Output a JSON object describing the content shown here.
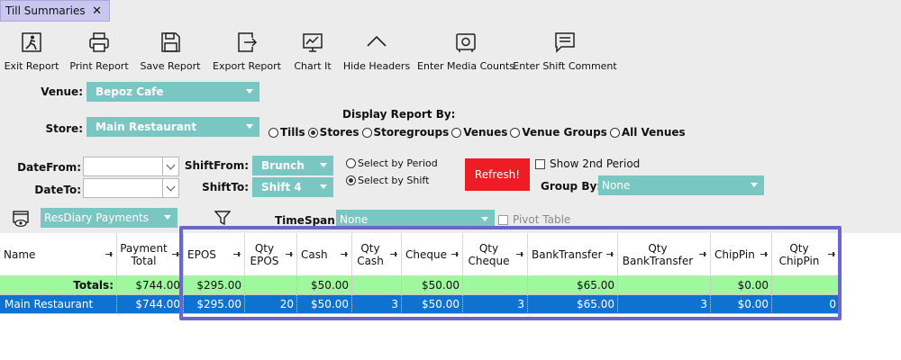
{
  "tab": {
    "title": "Till Summaries",
    "close": "✕"
  },
  "toolbar": [
    {
      "label": "Exit Report",
      "icon": "exit-icon"
    },
    {
      "label": "Print Report",
      "icon": "printer-icon"
    },
    {
      "label": "Save Report",
      "icon": "save-icon"
    },
    {
      "label": "Export Report",
      "icon": "export-icon"
    },
    {
      "label": "Chart It",
      "icon": "chart-icon"
    },
    {
      "label": "Hide Headers",
      "icon": "chevron-up-icon"
    },
    {
      "label": "Enter Media Counts",
      "icon": "safe-icon"
    },
    {
      "label": "Enter Shift Comment",
      "icon": "comment-icon"
    }
  ],
  "filters": {
    "venue_label": "Venue:",
    "venue_value": "Bepoz Cafe",
    "store_label": "Store:",
    "store_value": "Main Restaurant",
    "display_by_label": "Display Report By:",
    "display_by_options": [
      "Tills",
      "Stores",
      "Storegroups",
      "Venues",
      "Venue Groups",
      "All Venues"
    ],
    "display_by_selected": "Stores",
    "date_from_label": "DateFrom:",
    "date_to_label": "DateTo:",
    "shift_from_label": "ShiftFrom:",
    "shift_from_value": "Brunch",
    "shift_to_label": "ShiftTo:",
    "shift_to_value": "Shift 4",
    "select_by_period": "Select by Period",
    "select_by_shift": "Select by Shift",
    "select_by_selected": "shift",
    "refresh_label": "Refresh!",
    "show_2nd_period": "Show 2nd Period",
    "group_by_label": "Group By:",
    "group_by_value": "None",
    "report_type_value": "ResDiary Payments",
    "timespan_label": "TimeSpan:",
    "timespan_value": "None",
    "pivot_table": "Pivot Table"
  },
  "grid": {
    "columns": [
      {
        "line1": "",
        "line2": "Name"
      },
      {
        "line1": "Payment",
        "line2": "Total"
      },
      {
        "line1": "",
        "line2": "EPOS"
      },
      {
        "line1": "Qty",
        "line2": "EPOS"
      },
      {
        "line1": "",
        "line2": "Cash"
      },
      {
        "line1": "Qty",
        "line2": "Cash"
      },
      {
        "line1": "",
        "line2": "Cheque"
      },
      {
        "line1": "Qty",
        "line2": "Cheque"
      },
      {
        "line1": "",
        "line2": "BankTransfer"
      },
      {
        "line1": "Qty",
        "line2": "BankTransfer"
      },
      {
        "line1": "",
        "line2": "ChipPin"
      },
      {
        "line1": "Qty",
        "line2": "ChipPin"
      }
    ],
    "totals": [
      "Totals:",
      "$744.00",
      "$295.00",
      "",
      "$50.00",
      "",
      "$50.00",
      "",
      "$65.00",
      "",
      "$0.00",
      ""
    ],
    "rows": [
      [
        "Main Restaurant",
        "$744.00",
        "$295.00",
        "20",
        "$50.00",
        "3",
        "$50.00",
        "3",
        "$65.00",
        "3",
        "$0.00",
        "0"
      ]
    ]
  },
  "colors": {
    "accent": "#79c6c2",
    "tab": "#c9c7ef",
    "refresh": "#ee1c25",
    "totals": "#9ff79f",
    "selected": "#0d72d0",
    "highlight": "#6a67c9"
  }
}
